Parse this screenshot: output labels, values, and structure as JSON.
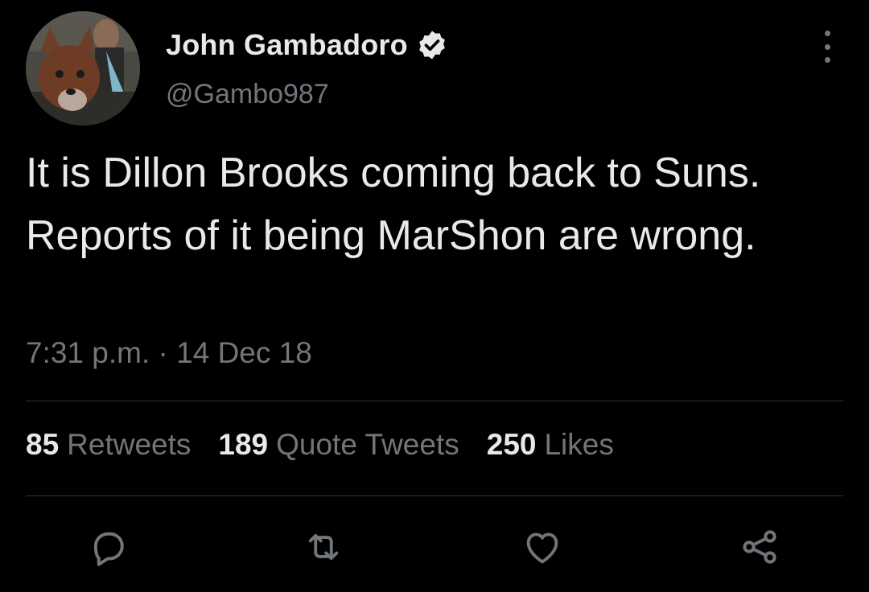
{
  "author": {
    "display_name": "John Gambadoro",
    "handle": "@Gambo987",
    "verified_icon": "verified-badge-icon",
    "avatar": "profile-photo"
  },
  "menu": {
    "icon": "more-options-icon"
  },
  "tweet": {
    "text": "It is Dillon Brooks coming back to Suns. Reports of it being MarShon are wrong.",
    "timestamp": "7:31 p.m. · 14 Dec 18"
  },
  "stats": {
    "retweets_count": "85",
    "retweets_label": "Retweets",
    "quotes_count": "189",
    "quotes_label": "Quote Tweets",
    "likes_count": "250",
    "likes_label": "Likes"
  },
  "actions": [
    {
      "name": "reply",
      "icon": "reply-icon"
    },
    {
      "name": "retweet",
      "icon": "retweet-icon"
    },
    {
      "name": "like",
      "icon": "heart-icon"
    },
    {
      "name": "share",
      "icon": "share-icon"
    }
  ],
  "colors": {
    "background": "#000000",
    "primary_text": "#e7e9ea",
    "secondary_text": "#71767b",
    "divider": "#2f3336"
  }
}
